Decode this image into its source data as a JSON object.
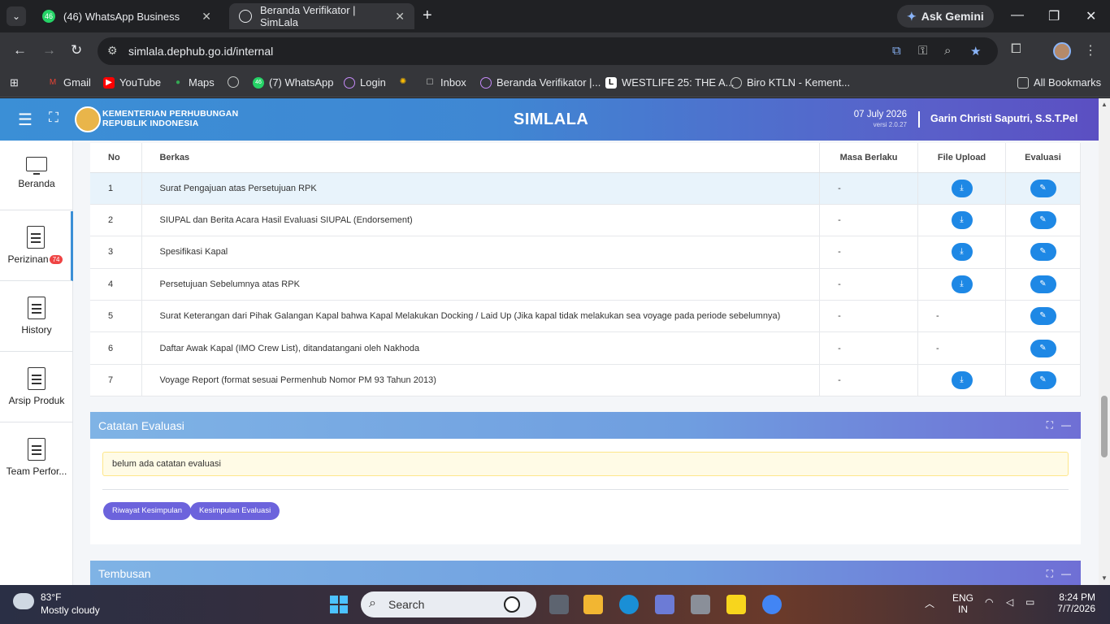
{
  "browser": {
    "tabs": [
      {
        "title": "(46) WhatsApp Business",
        "favicon_text": "46",
        "color": "#25d366"
      },
      {
        "title": "Beranda Verifikator | SimLala",
        "favicon_text": "",
        "color": "#e8eaed"
      }
    ],
    "gemini_label": "Ask Gemini",
    "url": "simlala.dephub.go.id/internal",
    "bookmarks": [
      {
        "label": "Gmail"
      },
      {
        "label": "YouTube"
      },
      {
        "label": "Maps"
      },
      {
        "label": ""
      },
      {
        "label": "(7) WhatsApp"
      },
      {
        "label": "Login"
      },
      {
        "label": ""
      },
      {
        "label": "Inbox"
      },
      {
        "label": "Beranda Verifikator |..."
      },
      {
        "label": "WESTLIFE 25: THE A..."
      },
      {
        "label": "Biro KTLN - Kement..."
      }
    ],
    "all_bookmarks_label": "All Bookmarks"
  },
  "header": {
    "ministry_line1": "KEMENTERIAN PERHUBUNGAN",
    "ministry_line2": "REPUBLIK INDONESIA",
    "brand": "SIMLALA",
    "date": "07 July 2026",
    "version": "versi 2.0.27",
    "user": "Garin Christi Saputri, S.S.T.Pel"
  },
  "sidebar": {
    "items": [
      {
        "label": "Beranda",
        "icon": "monitor-icon"
      },
      {
        "label": "Perizinan",
        "badge": "74",
        "icon": "document-icon"
      },
      {
        "label": "History",
        "icon": "document-icon"
      },
      {
        "label": "Arsip Produk",
        "icon": "document-icon"
      },
      {
        "label": "Team Perfor...",
        "icon": "document-icon"
      }
    ]
  },
  "table": {
    "headers": [
      "No",
      "Berkas",
      "Masa Berlaku",
      "File Upload",
      "Evaluasi"
    ],
    "rows": [
      {
        "no": "1",
        "berkas": "Surat Pengajuan atas Persetujuan RPK",
        "masa": "-",
        "file": true
      },
      {
        "no": "2",
        "berkas": "SIUPAL dan Berita Acara Hasil Evaluasi SIUPAL (Endorsement)",
        "masa": "-",
        "file": true
      },
      {
        "no": "3",
        "berkas": "Spesifikasi Kapal",
        "masa": "-",
        "file": true
      },
      {
        "no": "4",
        "berkas": "Persetujuan Sebelumnya atas RPK",
        "masa": "-",
        "file": true
      },
      {
        "no": "5",
        "berkas": "Surat Keterangan dari Pihak Galangan Kapal bahwa Kapal Melakukan Docking / Laid Up (Jika kapal tidak melakukan sea voyage pada periode sebelumnya)",
        "masa": "-",
        "file": false,
        "file_text": "-"
      },
      {
        "no": "6",
        "berkas": "Daftar Awak Kapal (IMO Crew List), ditandatangani oleh Nakhoda",
        "masa": "-",
        "file": false,
        "file_text": "-"
      },
      {
        "no": "7",
        "berkas": "Voyage Report (format sesuai Permenhub Nomor PM 93 Tahun 2013)",
        "masa": "-",
        "file": true
      }
    ]
  },
  "catatan": {
    "title": "Catatan Evaluasi",
    "note": "belum ada catatan evaluasi",
    "btn_riwayat": "Riwayat Kesimpulan",
    "btn_kesimpulan": "Kesimpulan Evaluasi"
  },
  "tembusan": {
    "title": "Tembusan"
  },
  "taskbar": {
    "temp": "83°F",
    "weather": "Mostly cloudy",
    "search": "Search",
    "lang1": "ENG",
    "lang2": "IN",
    "time": "8:24 PM",
    "date": "7/7/2026"
  },
  "colors": {
    "accent": "#1e88e5",
    "header_start": "#3b8fd6",
    "header_end": "#5b4fc2",
    "pill": "#6c63dc"
  }
}
